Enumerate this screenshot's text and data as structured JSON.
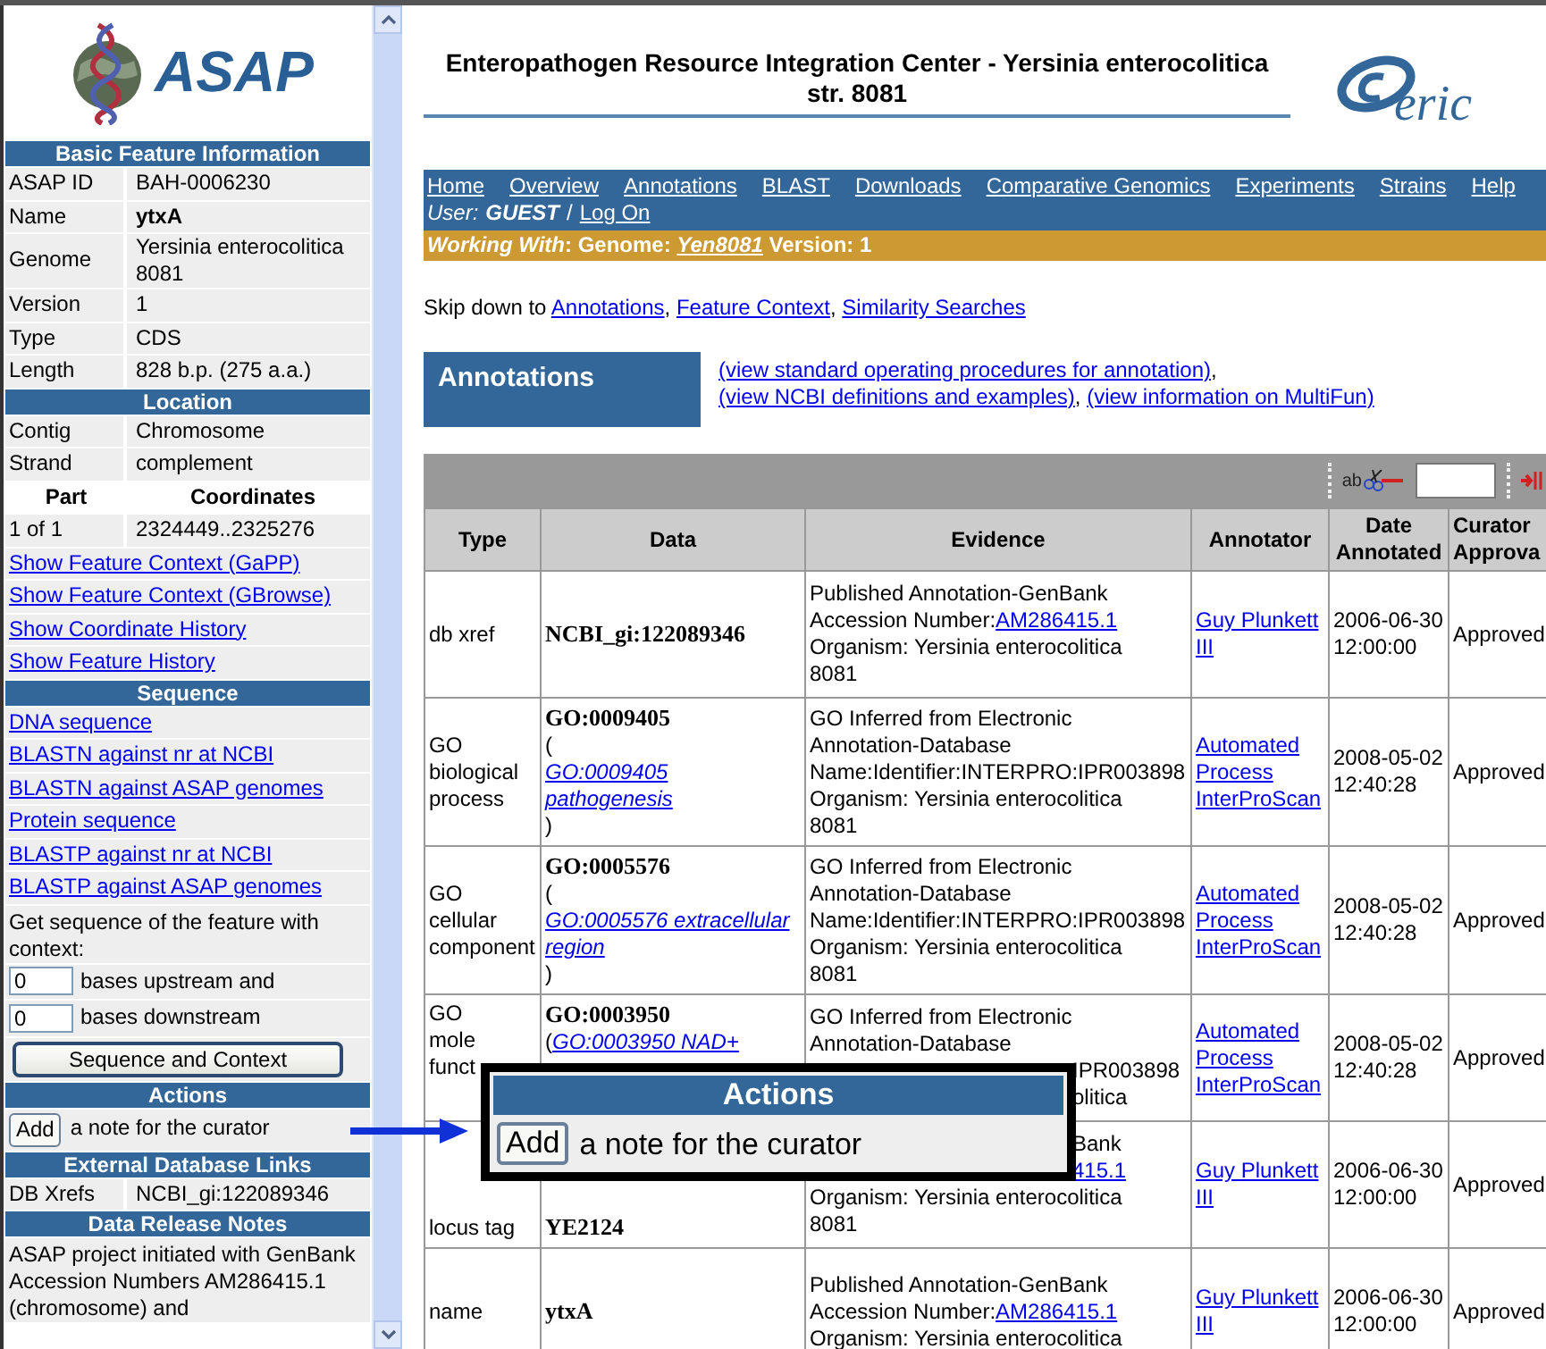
{
  "sidebar": {
    "logo": "ASAP",
    "sections": [
      {
        "title": "Basic Feature Information",
        "items": [
          {
            "kind": "field",
            "label": "ASAP ID",
            "value": "BAH-0006230",
            "bold": false
          },
          {
            "kind": "field",
            "label": "Name",
            "value": "ytxA",
            "bold": true
          },
          {
            "kind": "field",
            "label": "Genome",
            "value": "Yersinia enterocolitica 8081",
            "bold": false
          },
          {
            "kind": "field",
            "label": "Version",
            "value": "1",
            "bold": false
          },
          {
            "kind": "field",
            "label": "Type",
            "value": "CDS",
            "bold": false
          },
          {
            "kind": "field",
            "label": "Length",
            "value": "828 b.p. (275 a.a.)",
            "bold": false
          }
        ]
      },
      {
        "title": "Location",
        "items": [
          {
            "kind": "field",
            "label": "Contig",
            "value": "Chromosome",
            "bold": false
          },
          {
            "kind": "field",
            "label": "Strand",
            "value": "complement",
            "bold": false
          },
          {
            "kind": "header",
            "label": "Part",
            "value": "Coordinates"
          },
          {
            "kind": "field",
            "label": "1 of 1",
            "value": "2324449..2325276",
            "bold": false
          },
          {
            "kind": "link",
            "text": "Show Feature Context (GaPP)"
          },
          {
            "kind": "link",
            "text": "Show Feature Context (GBrowse)"
          },
          {
            "kind": "link",
            "text": "Show Coordinate History"
          },
          {
            "kind": "link",
            "text": "Show Feature History"
          }
        ]
      },
      {
        "title": "Sequence",
        "items": [
          {
            "kind": "link",
            "text": "DNA sequence"
          },
          {
            "kind": "link",
            "text": "BLASTN against nr at NCBI"
          },
          {
            "kind": "link",
            "text": "BLASTN against ASAP genomes"
          },
          {
            "kind": "link",
            "text": "Protein sequence"
          },
          {
            "kind": "link",
            "text": "BLASTP against nr at NCBI"
          },
          {
            "kind": "link",
            "text": "BLASTP against ASAP genomes"
          },
          {
            "kind": "text",
            "text": "Get sequence of the feature with context:"
          },
          {
            "kind": "input",
            "value": "0",
            "label": "bases upstream and"
          },
          {
            "kind": "input",
            "value": "0",
            "label": "bases downstream"
          },
          {
            "kind": "button",
            "text": "Sequence and Context"
          }
        ]
      },
      {
        "title": "Actions",
        "items": [
          {
            "kind": "action",
            "button": "Add",
            "text": "a note for the curator"
          }
        ]
      },
      {
        "title": "External Database Links",
        "items": [
          {
            "kind": "field",
            "label": "DB Xrefs",
            "value": "NCBI_gi:122089346",
            "bold": false
          }
        ]
      },
      {
        "title": "Data Release Notes",
        "items": [
          {
            "kind": "text",
            "text": "ASAP project initiated with GenBank Accession Numbers AM286415.1 (chromosome) and"
          }
        ]
      }
    ]
  },
  "header": {
    "title": "Enteropathogen Resource Integration Center - Yersinia enterocolitica str. 8081",
    "logo_text": "eric"
  },
  "nav": {
    "links": [
      "Home",
      "Overview",
      "Annotations",
      "BLAST",
      "Downloads",
      "Comparative Genomics",
      "Experiments",
      "Strains",
      "Help"
    ],
    "user_label": "User:",
    "user": "GUEST",
    "separator": "/",
    "login": "Log On"
  },
  "working": {
    "label": "Working With",
    "genome_label": ": Genome:",
    "genome": "Yen8081",
    "version": "Version: 1"
  },
  "skip": {
    "text": "Skip down to",
    "links": [
      "Annotations",
      "Feature Context",
      "Similarity Searches"
    ],
    "separator": ","
  },
  "annotations": {
    "title": "Annotations",
    "links": [
      "(view standard operating procedures for annotation)",
      "(view NCBI definitions and examples)",
      "(view information on MultiFun)"
    ],
    "separator": ","
  },
  "toolbar": {
    "icon_text": "ab"
  },
  "table": {
    "columns": [
      "Type",
      "Data",
      "Evidence",
      "Annotator",
      "Date Annotated",
      "Curator Approva"
    ],
    "rows": [
      {
        "type": [
          "db xref"
        ],
        "data": {
          "id": "NCBI_gi:122089346"
        },
        "evidence": [
          {
            "kind": "line",
            "text": "Published Annotation-GenBank"
          },
          {
            "kind": "line",
            "text": "Accession Number:",
            "link": "AM286415.1"
          },
          {
            "kind": "line",
            "text": "Organism:  Yersinia enterocolitica"
          },
          {
            "kind": "line",
            "text": "8081"
          }
        ],
        "annotator": "Guy Plunkett III",
        "date": "2006-06-30 12:00:00",
        "approval": "Approved"
      },
      {
        "type": [
          "GO",
          "biological",
          "process"
        ],
        "data": {
          "id": "GO:0009405",
          "before": "(",
          "link": "GO:0009405 pathogenesis",
          "after": ")"
        },
        "evidence": [
          {
            "kind": "line",
            "text": "GO Inferred from Electronic"
          },
          {
            "kind": "line",
            "text": "Annotation-Database"
          },
          {
            "kind": "line",
            "text": "Name:Identifier:INTERPRO:IPR003898"
          },
          {
            "kind": "line",
            "text": "Organism:  Yersinia enterocolitica"
          },
          {
            "kind": "line",
            "text": "8081"
          }
        ],
        "annotator": "Automated Process InterProScan",
        "date": "2008-05-02 12:40:28",
        "approval": "Approved"
      },
      {
        "type": [
          "GO cellular",
          "component"
        ],
        "data": {
          "id": "GO:0005576",
          "before": "(",
          "link": "GO:0005576 extracellular region",
          "after": ")"
        },
        "evidence": [
          {
            "kind": "line",
            "text": "GO Inferred from Electronic"
          },
          {
            "kind": "line",
            "text": "Annotation-Database"
          },
          {
            "kind": "line",
            "text": "Name:Identifier:INTERPRO:IPR003898"
          },
          {
            "kind": "line",
            "text": "Organism:  Yersinia enterocolitica"
          },
          {
            "kind": "line",
            "text": "8081"
          }
        ],
        "annotator": "Automated Process InterProScan",
        "date": "2008-05-02 12:40:28",
        "approval": "Approved"
      },
      {
        "type": [
          "GO",
          "mole",
          "funct"
        ],
        "data": {
          "id": "GO:0003950",
          "before": "(",
          "link": "GO:0003950 NAD+"
        },
        "evidence": [
          {
            "kind": "line",
            "text": "GO Inferred from Electronic"
          },
          {
            "kind": "line",
            "text": "Annotation-Database"
          },
          {
            "kind": "tail",
            "text": "IPR003898"
          },
          {
            "kind": "tail",
            "text": "olitica"
          }
        ],
        "annotator": "Automated Process InterProScan",
        "date": "2008-05-02 12:40:28",
        "approval": "Approved"
      },
      {
        "type": [
          "locus tag"
        ],
        "data": {
          "id": "YE2124"
        },
        "evidence": [
          {
            "kind": "tail",
            "text": "Bank"
          },
          {
            "kind": "tail",
            "link": "415.1"
          },
          {
            "kind": "line",
            "text": "Organism:  Yersinia enterocolitica"
          },
          {
            "kind": "line",
            "text": "8081"
          }
        ],
        "annotator": "Guy Plunkett III",
        "date": "2006-06-30 12:00:00",
        "approval": "Approved"
      },
      {
        "type": [
          "name"
        ],
        "data": {
          "id": "ytxA"
        },
        "evidence": [
          {
            "kind": "line",
            "text": "Published Annotation-GenBank"
          },
          {
            "kind": "line",
            "text": "Accession Number:",
            "link": "AM286415.1"
          },
          {
            "kind": "line",
            "text": "Organism:  Yersinia enterocolitica"
          }
        ],
        "annotator": "Guy Plunkett III",
        "date": "2006-06-30 12:00:00",
        "approval": "Approved"
      }
    ]
  },
  "callout": {
    "title": "Actions",
    "button": "Add",
    "text": "a note for the curator"
  }
}
